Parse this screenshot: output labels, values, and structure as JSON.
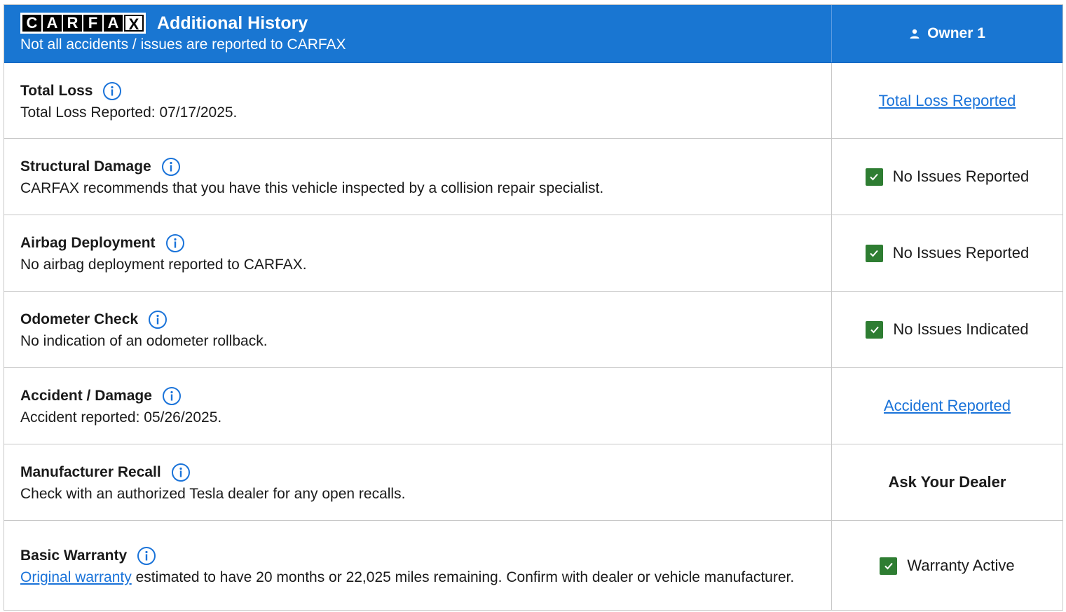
{
  "header": {
    "logo_letters": [
      "C",
      "A",
      "R",
      "F",
      "A",
      "X"
    ],
    "title": "Additional History",
    "subtitle": "Not all accidents / issues are reported to CARFAX",
    "owner_label": "Owner 1"
  },
  "rows": [
    {
      "title": "Total Loss",
      "desc": "Total Loss Reported: 07/17/2025.",
      "status": "Total Loss Reported",
      "status_type": "link"
    },
    {
      "title": "Structural Damage",
      "desc": "CARFAX recommends that you have this vehicle inspected by a collision repair specialist.",
      "status": "No Issues Reported",
      "status_type": "check"
    },
    {
      "title": "Airbag Deployment",
      "desc": "No airbag deployment reported to CARFAX.",
      "status": "No Issues Reported",
      "status_type": "check"
    },
    {
      "title": "Odometer Check",
      "desc": "No indication of an odometer rollback.",
      "status": "No Issues Indicated",
      "status_type": "check"
    },
    {
      "title": "Accident / Damage",
      "desc": "Accident reported: 05/26/2025.",
      "status": "Accident Reported",
      "status_type": "link"
    },
    {
      "title": "Manufacturer Recall",
      "desc": "Check with an authorized Tesla dealer for any open recalls.",
      "status": "Ask Your Dealer",
      "status_type": "bold"
    },
    {
      "title": "Basic Warranty",
      "desc_link": "Original warranty",
      "desc": " estimated to have 20 months or 22,025 miles remaining. Confirm with dealer or vehicle manufacturer.",
      "status": "Warranty Active",
      "status_type": "check"
    }
  ],
  "colors": {
    "header_blue": "#1976d2",
    "link_blue": "#1a73d9",
    "check_green": "#2e7d32"
  },
  "icons": {
    "info": "info-circle-icon",
    "owner": "person-icon",
    "check": "checkbox-checked-icon"
  }
}
